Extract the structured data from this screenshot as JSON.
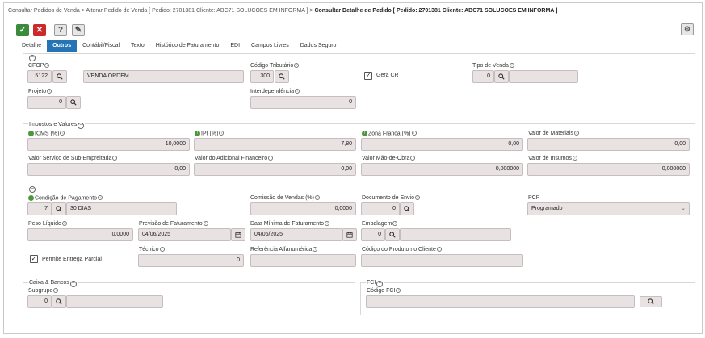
{
  "breadcrumb": {
    "items": [
      "Consultar Pedidos de Venda",
      "Alterar Pedido de Venda [ Pedido: 2701381 Cliente: ABC71 SOLUCOES EM INFORMA ]"
    ],
    "current": "Consultar Detalhe de Pedido [ Pedido: 2701381 Cliente: ABC71 SOLUCOES EM INFORMA ]",
    "sep": ">"
  },
  "toolbar": {
    "ok": "✓",
    "cancel": "✕",
    "help": "?",
    "tool": "✎",
    "gear": "⚙"
  },
  "tabs": [
    "Detalhe",
    "Outros",
    "Contábil/Fiscal",
    "Texto",
    "Histórico de Faturamento",
    "EDI",
    "Campos Livres",
    "Dados Seguro"
  ],
  "active_tab": "Outros",
  "general": {
    "cfop_label": "CFOP",
    "cfop_code": "5122",
    "cfop_desc": "VENDA ORDEM",
    "cod_trib_label": "Código Tributário",
    "cod_trib_value": "300",
    "gera_cr_label": "Gera CR",
    "gera_cr_checked": true,
    "tipo_venda_label": "Tipo de Venda",
    "tipo_venda_code": "0",
    "tipo_venda_desc": "",
    "projeto_label": "Projeto",
    "projeto_value": "0",
    "interdependencia_label": "Interdependência",
    "interdependencia_value": "0"
  },
  "impostos": {
    "title": "Impostos e Valores",
    "icms_label": "ICMS (%)",
    "icms_value": "10,0000",
    "ipi_label": "IPI (%)",
    "ipi_value": "7,80",
    "zona_franca_label": "Zona Franca (%)",
    "zona_franca_value": "0,00",
    "valor_materiais_label": "Valor de Materiais",
    "valor_materiais_value": "0,00",
    "valor_servico_label": "Valor Serviço de Sub-Empreitada",
    "valor_servico_value": "0,00",
    "valor_adicional_label": "Valor do Adicional Financeiro",
    "valor_adicional_value": "0,00",
    "valor_mao_obra_label": "Valor Mão-de-Obra",
    "valor_mao_obra_value": "0,000000",
    "valor_insumos_label": "Valor de Insumos",
    "valor_insumos_value": "0,000000"
  },
  "pagamento": {
    "cond_pag_label": "Condição de Pagamento",
    "cond_pag_code": "7",
    "cond_pag_desc": "30 DIAS",
    "comissao_label": "Comissão de Vendas (%)",
    "comissao_value": "0,0000",
    "doc_envio_label": "Documento de Envio",
    "doc_envio_value": "0",
    "pcp_label": "PCP",
    "pcp_value": "Programado",
    "peso_label": "Peso Líquido",
    "peso_value": "0,0000",
    "prev_fat_label": "Previsão de Faturamento",
    "prev_fat_value": "04/06/2025",
    "data_min_label": "Data Mínima de Faturamento",
    "data_min_value": "04/06/2025",
    "embalagem_label": "Embalagem",
    "embalagem_value": "0",
    "permite_label": "Permite Entrega Parcial",
    "permite_checked": true,
    "tecnico_label": "Técnico",
    "tecnico_value": "0",
    "ref_alfa_label": "Referência Alfanumérica",
    "ref_alfa_value": "",
    "cod_prod_cliente_label": "Código do Produto no Cliente",
    "cod_prod_cliente_value": ""
  },
  "caixa": {
    "title": "Caixa & Bancos",
    "subgrupo_label": "Subgrupo",
    "subgrupo_value": "0"
  },
  "fci": {
    "title": "FCI",
    "codigo_label": "Código FCI",
    "codigo_value": ""
  },
  "colors": {
    "tab_active": "#2574b6",
    "ok": "#3c8a3c",
    "cancel": "#cc2a2a",
    "field_bg": "#e9e2e3",
    "indicator": "#4a9a3a"
  }
}
